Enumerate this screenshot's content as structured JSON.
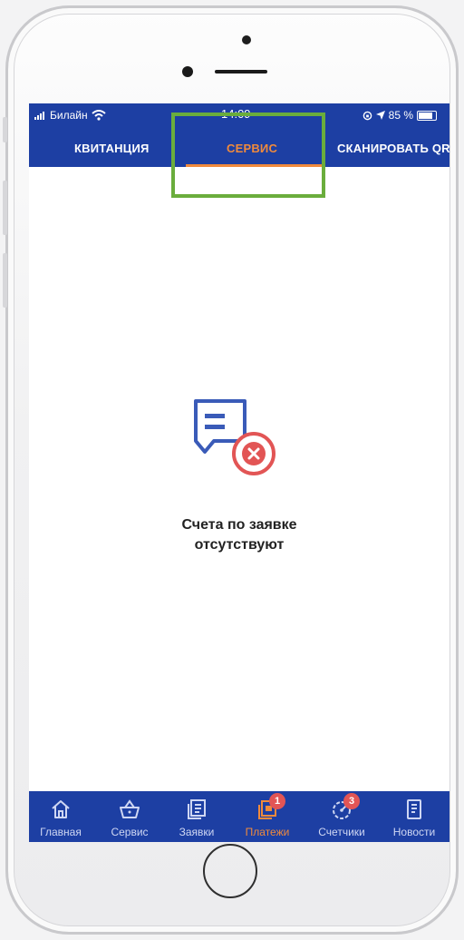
{
  "status_bar": {
    "carrier": "Билайн",
    "time": "14:09",
    "battery": "85 %"
  },
  "tabs": [
    {
      "label": "КВИТАНЦИЯ",
      "active": false
    },
    {
      "label": "СЕРВИС",
      "active": true
    },
    {
      "label": "СКАНИРОВАТЬ QR",
      "active": false
    }
  ],
  "empty_state": {
    "icon": "receipt-cancel-icon",
    "line1": "Счета по заявке",
    "line2": "отсутствуют"
  },
  "bottom_nav": [
    {
      "label": "Главная",
      "icon": "home-icon",
      "active": false
    },
    {
      "label": "Сервис",
      "icon": "basket-icon",
      "active": false
    },
    {
      "label": "Заявки",
      "icon": "requests-icon",
      "active": false
    },
    {
      "label": "Платежи",
      "icon": "payments-icon",
      "active": true,
      "badge": "1"
    },
    {
      "label": "Счетчики",
      "icon": "meter-icon",
      "active": false,
      "badge": "3"
    },
    {
      "label": "Новости",
      "icon": "news-icon",
      "active": false
    }
  ],
  "colors": {
    "header_blue": "#1d3fa3",
    "accent_orange": "#f08a3c",
    "badge_red": "#e25555",
    "highlight_green": "#6aad3c"
  }
}
